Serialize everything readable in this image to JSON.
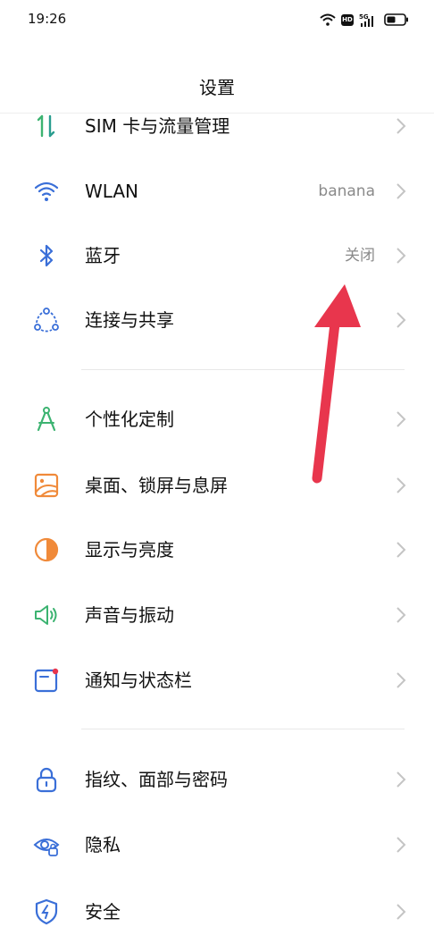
{
  "status_bar": {
    "time": "19:26",
    "hd": "HD",
    "network": "5G"
  },
  "header": {
    "title": "设置"
  },
  "items": [
    {
      "label": "SIM 卡与流量管理",
      "value": ""
    },
    {
      "label": "WLAN",
      "value": "banana"
    },
    {
      "label": "蓝牙",
      "value": "关闭"
    },
    {
      "label": "连接与共享",
      "value": ""
    },
    {
      "label": "个性化定制",
      "value": ""
    },
    {
      "label": "桌面、锁屏与息屏",
      "value": ""
    },
    {
      "label": "显示与亮度",
      "value": ""
    },
    {
      "label": "声音与振动",
      "value": ""
    },
    {
      "label": "通知与状态栏",
      "value": ""
    },
    {
      "label": "指纹、面部与密码",
      "value": ""
    },
    {
      "label": "隐私",
      "value": ""
    },
    {
      "label": "安全",
      "value": ""
    }
  ],
  "colors": {
    "accent_red": "#e8364d",
    "icon_blue": "#3a6fd8",
    "icon_green": "#3cb371",
    "icon_orange": "#f08a3a"
  }
}
